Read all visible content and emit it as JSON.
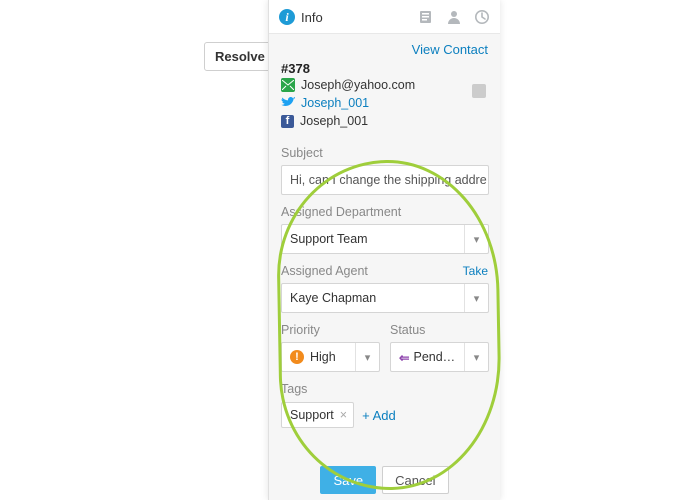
{
  "resolve": {
    "label": "Resolve"
  },
  "header": {
    "label": "Info",
    "icons": {
      "info": "info-icon",
      "book": "contacts-icon",
      "person": "person-icon",
      "clock": "history-icon"
    }
  },
  "links": {
    "view_contact": "View Contact",
    "take": "Take",
    "add_tag": "+ Add"
  },
  "contact": {
    "id": "#378",
    "email": "Joseph@yahoo.com",
    "twitter": "Joseph_001",
    "facebook": "Joseph_001"
  },
  "labels": {
    "subject": "Subject",
    "department": "Assigned Department",
    "agent": "Assigned Agent",
    "priority": "Priority",
    "status": "Status",
    "tags": "Tags"
  },
  "form": {
    "subject": "Hi, can I change the shipping addre",
    "department": "Support Team",
    "agent": "Kaye Chapman",
    "priority": "High",
    "status": "Pend…",
    "tags": [
      "Support"
    ]
  },
  "actions": {
    "save": "Save",
    "cancel": "Cancel"
  }
}
